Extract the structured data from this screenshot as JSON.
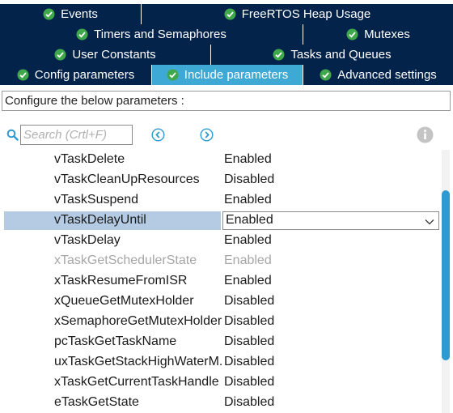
{
  "tabs": {
    "row1": [
      "Events",
      "FreeRTOS Heap Usage"
    ],
    "row2": [
      "Timers and Semaphores",
      "Mutexes"
    ],
    "row3": [
      "User Constants",
      "Tasks and Queues"
    ],
    "row4": [
      "Config parameters",
      "Include parameters",
      "Advanced settings"
    ],
    "active": "Include parameters"
  },
  "description": "Configure the below parameters :",
  "search": {
    "placeholder": "Search (Crtl+F)"
  },
  "parameters": [
    {
      "name": "vTaskDelete",
      "value": "Enabled"
    },
    {
      "name": "vTaskCleanUpResources",
      "value": "Disabled"
    },
    {
      "name": "vTaskSuspend",
      "value": "Enabled"
    },
    {
      "name": "vTaskDelayUntil",
      "value": "Enabled",
      "selected": true
    },
    {
      "name": "vTaskDelay",
      "value": "Enabled"
    },
    {
      "name": "xTaskGetSchedulerState",
      "value": "Enabled",
      "disabled": true
    },
    {
      "name": "xTaskResumeFromISR",
      "value": "Enabled"
    },
    {
      "name": "xQueueGetMutexHolder",
      "value": "Disabled"
    },
    {
      "name": "xSemaphoreGetMutexHolder",
      "value": "Disabled"
    },
    {
      "name": "pcTaskGetTaskName",
      "value": "Disabled"
    },
    {
      "name": "uxTaskGetStackHighWaterM.",
      "value": "Disabled"
    },
    {
      "name": "xTaskGetCurrentTaskHandle",
      "value": "Disabled"
    },
    {
      "name": "eTaskGetState",
      "value": "Disabled"
    }
  ],
  "colors": {
    "tab_bg": "#03234b",
    "tab_active": "#3fa9d6",
    "selection": "#b5cbe3",
    "scroll_thumb": "#2e9ad0",
    "icon_green": "#3fa84a"
  },
  "icons": {
    "tab": "check-circle-icon",
    "search": "search-icon",
    "prev": "chevron-left-circle-icon",
    "next": "chevron-right-circle-icon",
    "info": "info-icon",
    "dropdown": "chevron-down-icon"
  }
}
